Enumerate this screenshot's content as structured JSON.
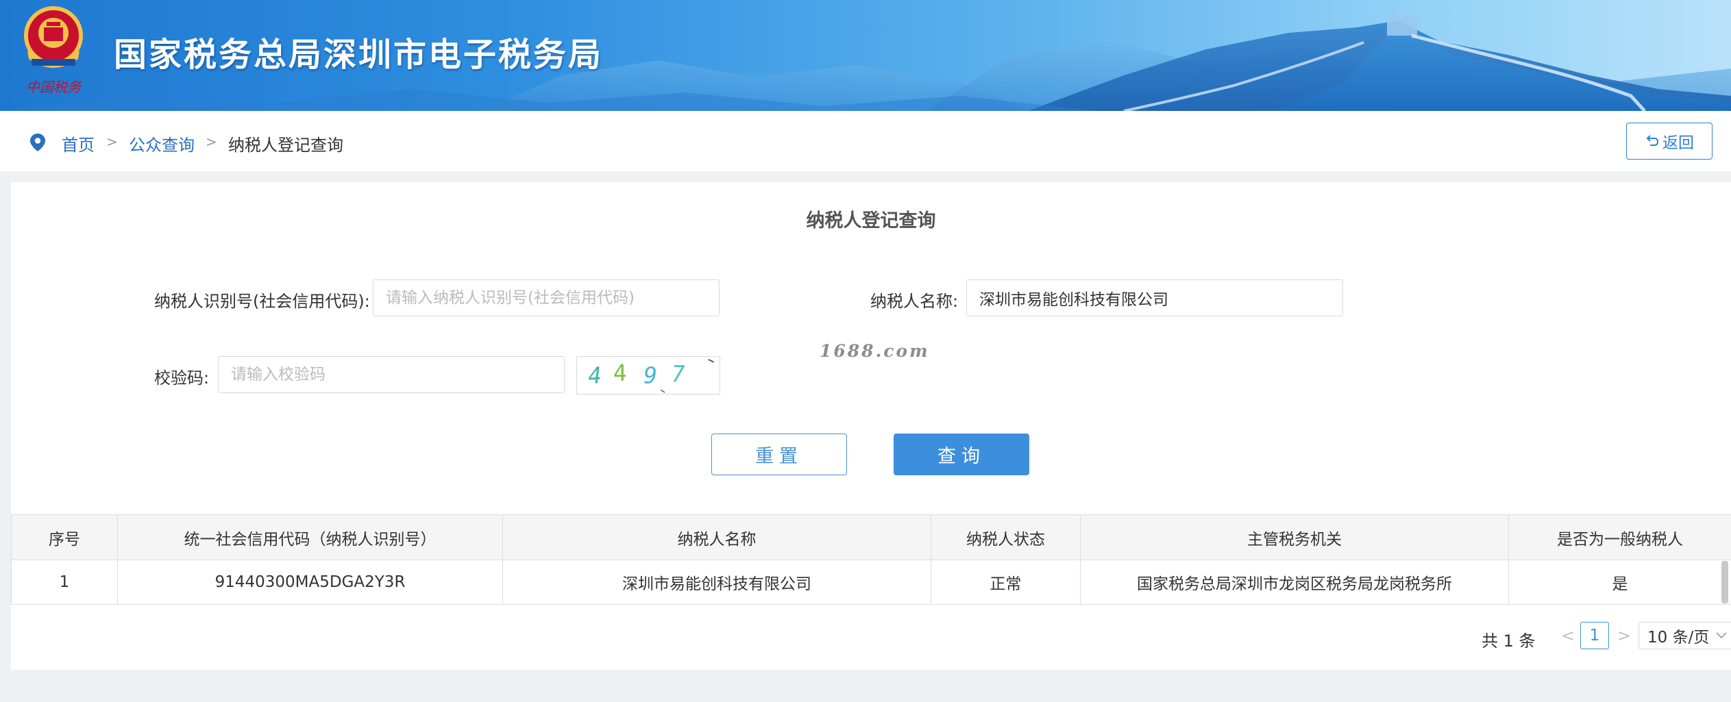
{
  "header": {
    "emblem_text": "中国税务",
    "title": "国家税务总局深圳市电子税务局"
  },
  "breadcrumb": {
    "home": "首页",
    "sep": ">",
    "public_query": "公众查询",
    "current": "纳税人登记查询"
  },
  "back_button": "返回",
  "form": {
    "title": "纳税人登记查询",
    "taxpayer_id_label": "纳税人识别号(社会信用代码):",
    "taxpayer_id_placeholder": "请输入纳税人识别号(社会信用代码)",
    "taxpayer_id_value": "",
    "taxpayer_name_label": "纳税人名称:",
    "taxpayer_name_value": "深圳市易能创科技有限公司",
    "captcha_label": "校验码:",
    "captcha_placeholder": "请输入校验码",
    "captcha_value": "",
    "captcha_image_text": [
      "4",
      "4",
      "9",
      "7"
    ],
    "reset_label": "重置",
    "query_label": "查询"
  },
  "watermark": "1688.com",
  "table": {
    "headers": [
      "序号",
      "统一社会信用代码（纳税人识别号）",
      "纳税人名称",
      "纳税人状态",
      "主管税务机关",
      "是否为一般纳税人"
    ],
    "rows": [
      [
        "1",
        "91440300MA5DGA2Y3R",
        "深圳市易能创科技有限公司",
        "正常",
        "国家税务总局深圳市龙岗区税务局龙岗税务所",
        "是"
      ]
    ]
  },
  "pagination": {
    "total": "共 1 条",
    "prev": "<",
    "current_page": "1",
    "next": ">",
    "page_size": "10 条/页"
  },
  "colors": {
    "primary": "#3d8fde",
    "link": "#2a6fc2",
    "banner_start": "#1e78d0",
    "banner_end": "#b8e2fa"
  }
}
